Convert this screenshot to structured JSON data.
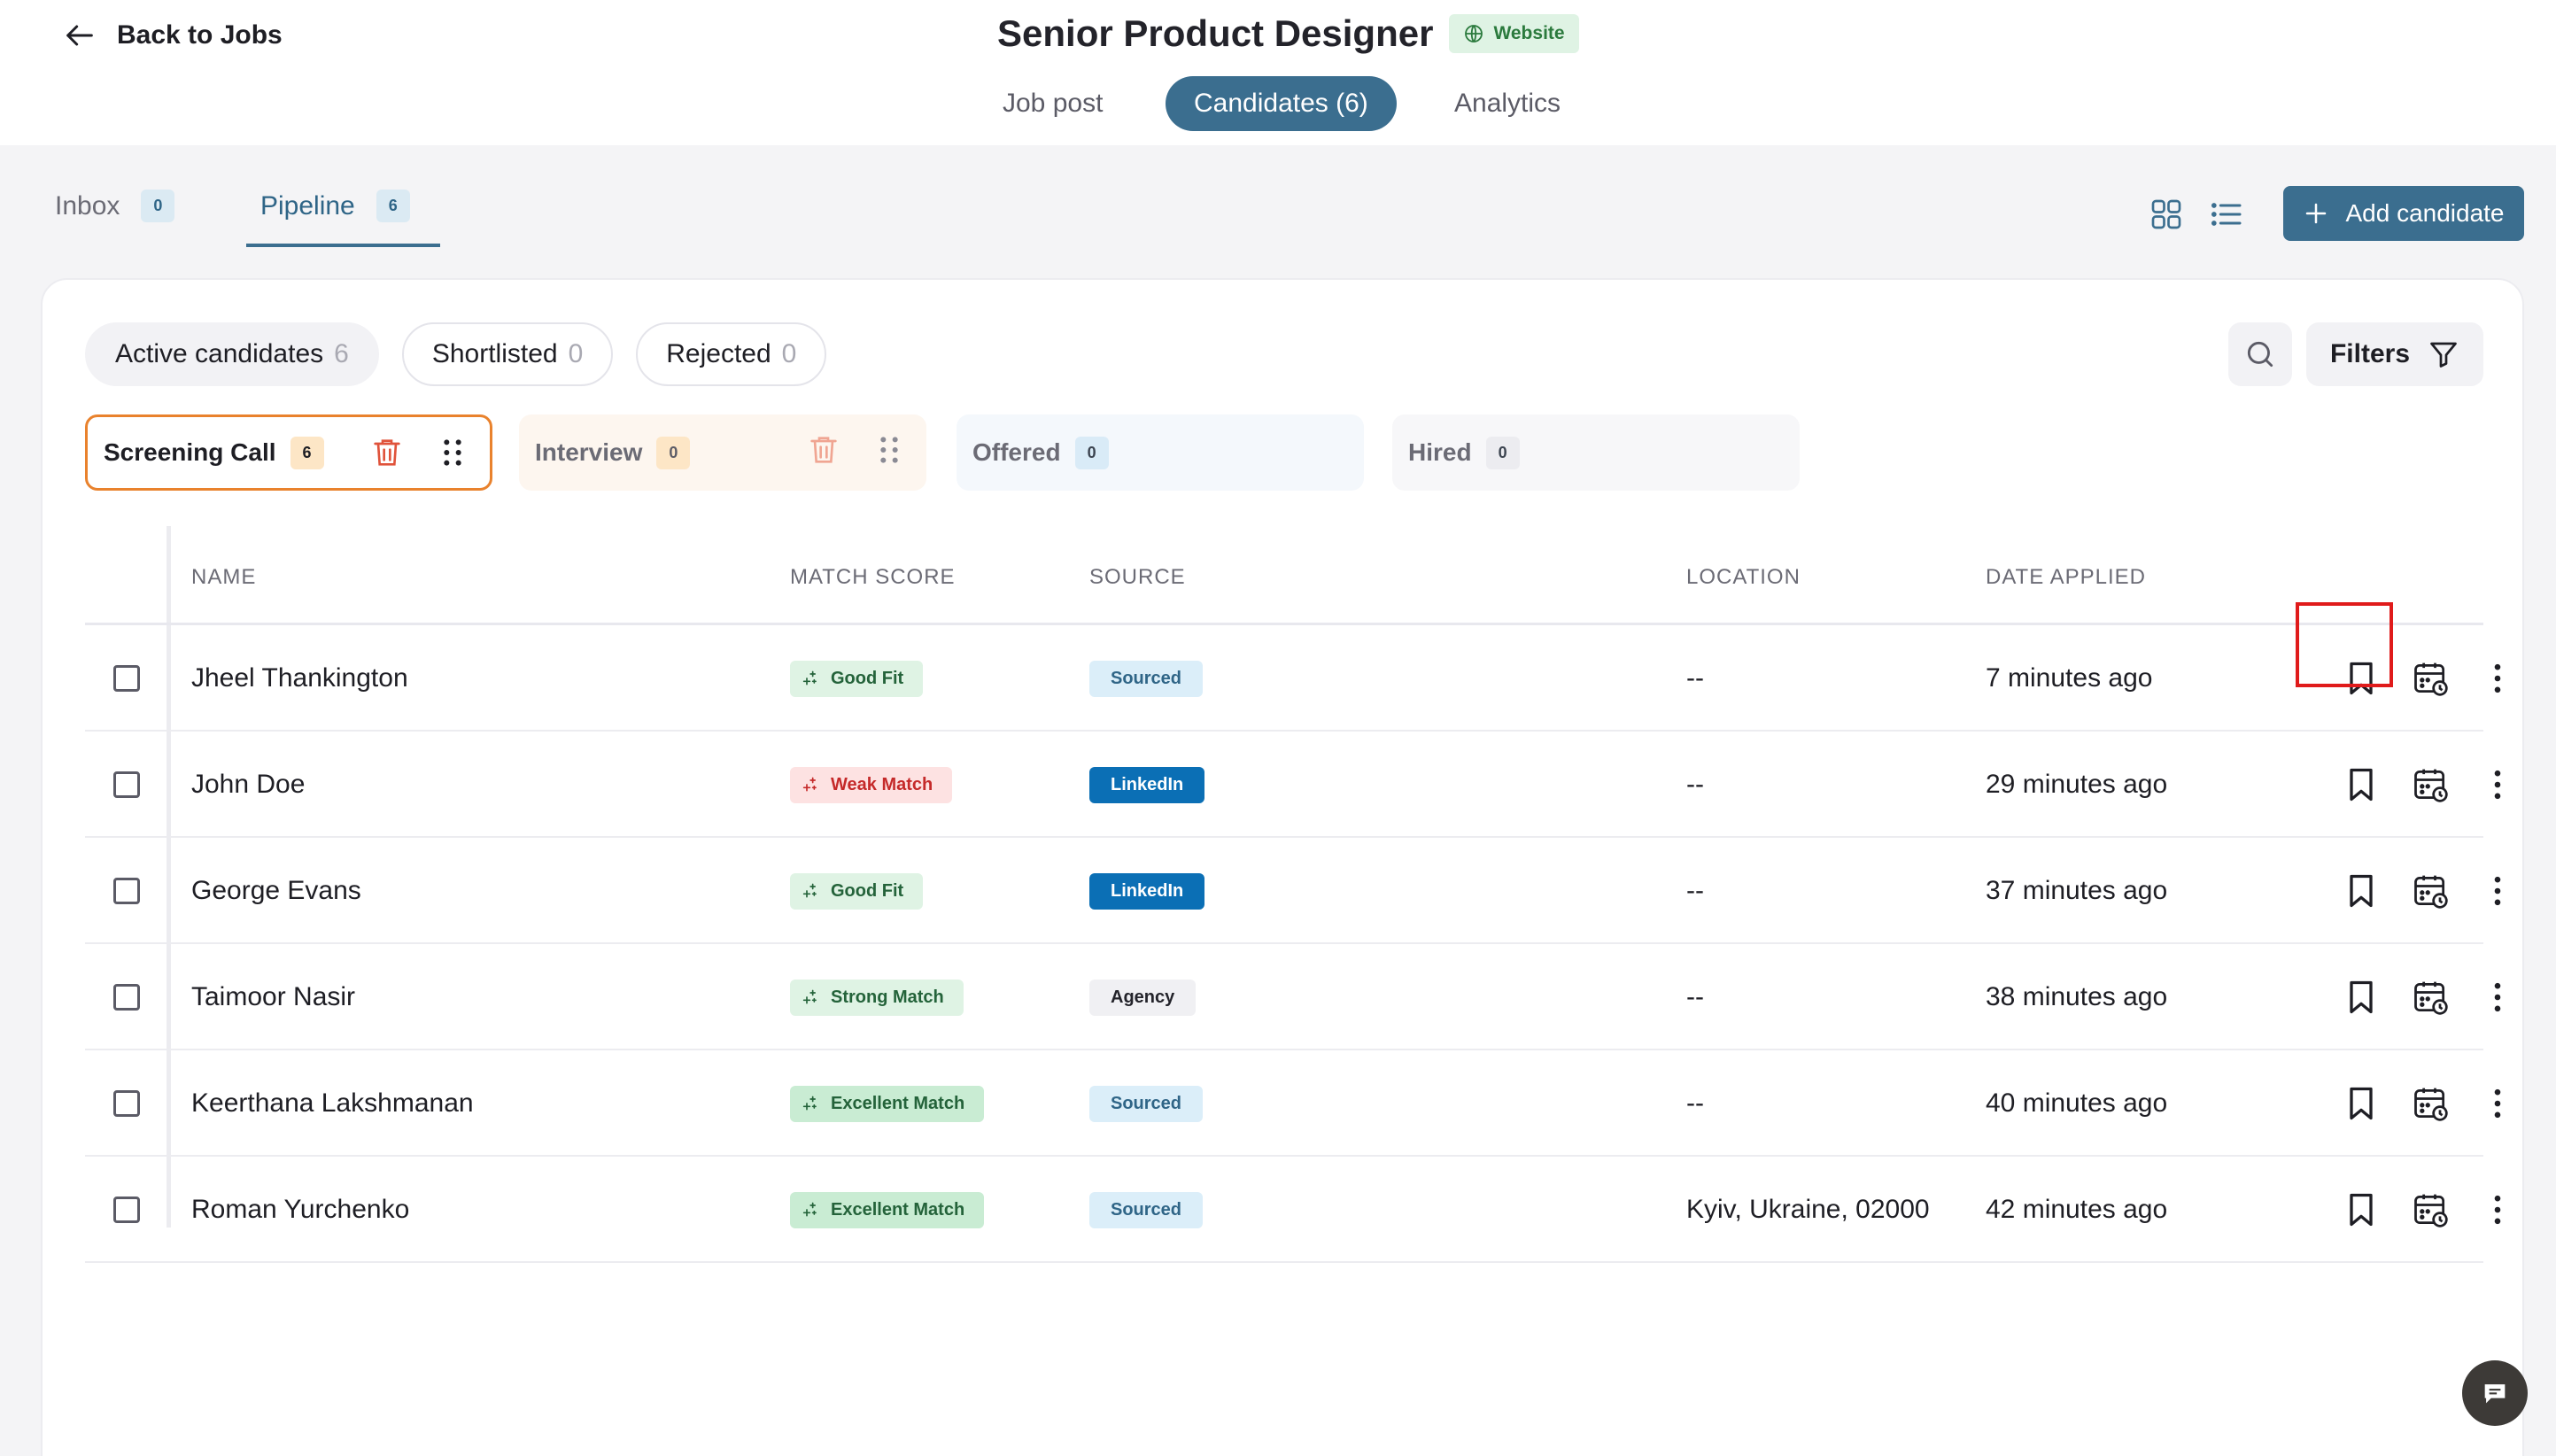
{
  "header": {
    "back_label": "Back to Jobs",
    "job_title": "Senior Product Designer",
    "badge": "Website",
    "tabs": [
      {
        "label": "Job post",
        "active": false
      },
      {
        "label": "Candidates (6)",
        "active": true
      },
      {
        "label": "Analytics",
        "active": false
      }
    ]
  },
  "subnav": {
    "tabs": [
      {
        "label": "Inbox",
        "count": "0",
        "active": false
      },
      {
        "label": "Pipeline",
        "count": "6",
        "active": true
      }
    ],
    "add_button": "Add candidate"
  },
  "filters": {
    "chips": [
      {
        "label": "Active candidates",
        "count": "6",
        "active": true
      },
      {
        "label": "Shortlisted",
        "count": "0",
        "active": false
      },
      {
        "label": "Rejected",
        "count": "0",
        "active": false
      }
    ],
    "filters_button": "Filters"
  },
  "stages": [
    {
      "label": "Screening Call",
      "count": "6",
      "selected": true
    },
    {
      "label": "Interview",
      "count": "0",
      "selected": false
    },
    {
      "label": "Offered",
      "count": "0",
      "selected": false
    },
    {
      "label": "Hired",
      "count": "0",
      "selected": false
    }
  ],
  "table": {
    "columns": [
      "NAME",
      "MATCH SCORE",
      "SOURCE",
      "LOCATION",
      "DATE APPLIED"
    ],
    "rows": [
      {
        "name": "Jheel Thankington",
        "match": "Good Fit",
        "source": "Sourced",
        "location": "--",
        "date": "7 minutes ago"
      },
      {
        "name": "John Doe",
        "match": "Weak Match",
        "source": "LinkedIn",
        "location": "--",
        "date": "29 minutes ago"
      },
      {
        "name": "George Evans",
        "match": "Good Fit",
        "source": "LinkedIn",
        "location": "--",
        "date": "37 minutes ago"
      },
      {
        "name": "Taimoor Nasir",
        "match": "Strong Match",
        "source": "Agency",
        "location": "--",
        "date": "38 minutes ago"
      },
      {
        "name": "Keerthana Lakshmanan",
        "match": "Excellent Match",
        "source": "Sourced",
        "location": "--",
        "date": "40 minutes ago"
      },
      {
        "name": "Roman Yurchenko",
        "match": "Excellent Match",
        "source": "Sourced",
        "location": "Kyiv, Ukraine, 02000",
        "date": "42 minutes ago"
      }
    ]
  },
  "colors": {
    "primary": "#3b6e8f",
    "stage_selected_border": "#e9822d",
    "highlight_box": "#e01b1b"
  },
  "icons": {
    "back": "arrow-left-icon",
    "badge": "globe-icon",
    "grid_view": "grid-icon",
    "list_view": "list-icon",
    "add": "plus-icon",
    "search": "search-icon",
    "filters": "filter-icon",
    "stage_delete": "trash-icon",
    "stage_drag": "drag-handle-icon",
    "match": "sparkle-icon",
    "row_bookmark": "bookmark-icon",
    "row_schedule": "calendar-icon",
    "row_more": "more-vertical-icon",
    "chat": "chat-icon"
  }
}
